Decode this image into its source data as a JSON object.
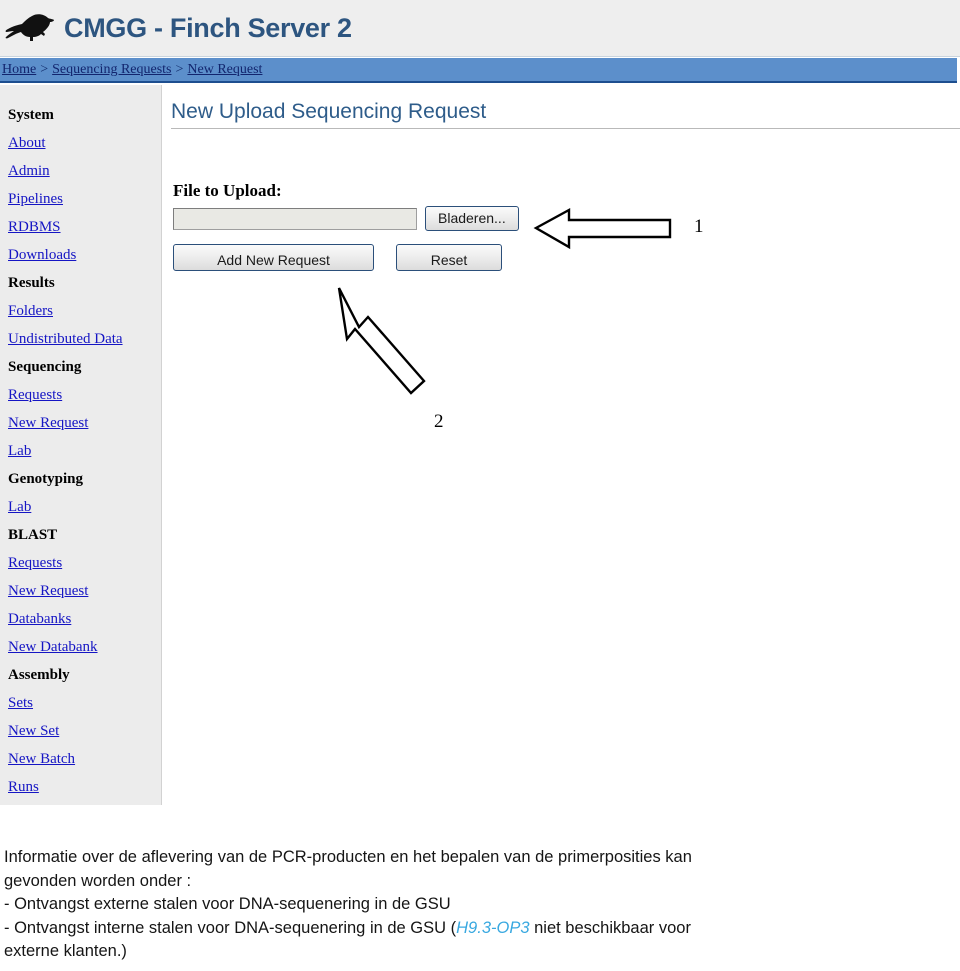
{
  "header": {
    "logo_icon": "finch-bird-icon",
    "title": "CMGG - Finch Server 2"
  },
  "breadcrumb": {
    "separator": ">",
    "items": [
      {
        "label": "Home"
      },
      {
        "label": "Sequencing Requests"
      },
      {
        "label": "New Request"
      }
    ]
  },
  "sidebar": {
    "groups": [
      {
        "title": "System",
        "links": [
          {
            "label": "About"
          },
          {
            "label": "Admin"
          },
          {
            "label": "Pipelines"
          },
          {
            "label": "RDBMS"
          },
          {
            "label": "Downloads"
          }
        ]
      },
      {
        "title": "Results",
        "links": [
          {
            "label": "Folders"
          },
          {
            "label": "Undistributed Data"
          }
        ]
      },
      {
        "title": "Sequencing",
        "links": [
          {
            "label": "Requests"
          },
          {
            "label": "New Request"
          },
          {
            "label": "Lab"
          }
        ]
      },
      {
        "title": "Genotyping",
        "links": [
          {
            "label": "Lab"
          }
        ]
      },
      {
        "title": "BLAST",
        "links": [
          {
            "label": "Requests"
          },
          {
            "label": "New Request"
          },
          {
            "label": "Databanks"
          },
          {
            "label": "New Databank"
          }
        ]
      },
      {
        "title": "Assembly",
        "links": [
          {
            "label": "Sets"
          },
          {
            "label": "New Set"
          },
          {
            "label": "New Batch"
          },
          {
            "label": "Runs"
          }
        ]
      }
    ]
  },
  "main": {
    "page_title": "New Upload Sequencing Request",
    "form": {
      "file_label": "File to Upload:",
      "file_value": "",
      "file_placeholder": "",
      "browse_label": "Bladeren...",
      "submit_label": "Add New Request",
      "reset_label": "Reset"
    }
  },
  "annotations": {
    "marker_1": "1",
    "marker_2": "2",
    "arrow_1_icon": "left-arrow-annotation-icon",
    "arrow_2_icon": "up-left-arrow-annotation-icon"
  },
  "bottom_note": {
    "line1": "Informatie over de aflevering van de PCR-producten en het bepalen van de primerposities kan",
    "line2": "gevonden worden onder :",
    "line3": "- Ontvangst externe stalen voor DNA-sequenering in de GSU",
    "line4_before": "- Ontvangst interne stalen voor DNA-sequenering in de GSU (",
    "line4_highlight": "H9.3-OP3",
    "line4_after": " niet beschikbaar voor",
    "line5": "externe klanten.)"
  },
  "colors": {
    "header_bg": "#eeeeee",
    "breadcrumb_bg": "#5c8fcb",
    "breadcrumb_link": "#12256e",
    "sidebar_bg": "#ececec",
    "nav_link": "#1515c4",
    "title_blue": "#2e5c8a",
    "highlight_blue": "#38a8e0"
  }
}
